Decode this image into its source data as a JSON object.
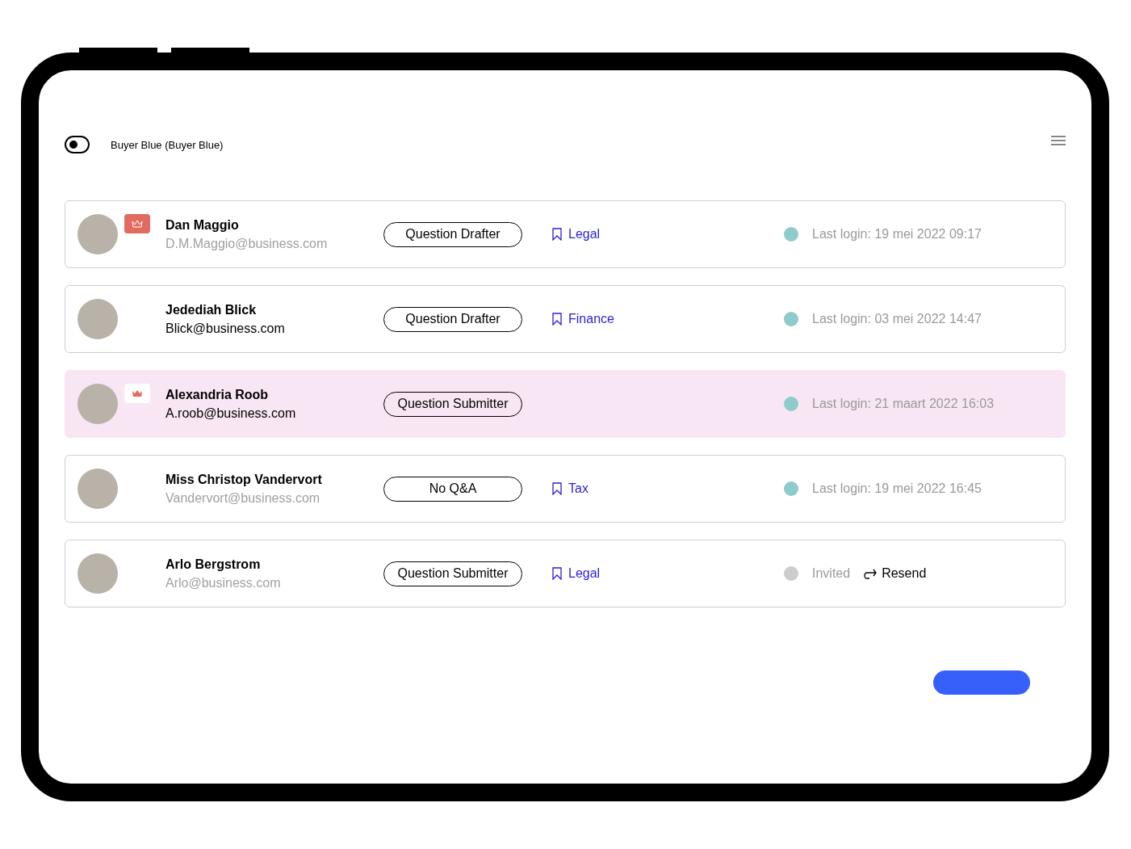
{
  "header": {
    "toggle_on": false,
    "account": "Buyer Blue (Buyer Blue)"
  },
  "users": [
    {
      "name": "Dan Maggio",
      "email": "D.M.Maggio@business.com",
      "email_muted": true,
      "badge": {
        "kind": "outline"
      },
      "role": "Question Drafter",
      "tag": "Legal",
      "color": "#8ecbcb",
      "status": "Last login: 19 mei 2022 09:17",
      "selected": false
    },
    {
      "name": "Jedediah Blick",
      "email": "Blick@business.com",
      "email_muted": false,
      "role": "Question Drafter",
      "tag": "Finance",
      "color": "#8ecbcb",
      "status": "Last login: 03 mei 2022 14:47",
      "selected": false
    },
    {
      "name": "Alexandria Roob",
      "email": "A.roob@business.com",
      "email_muted": false,
      "badge": {
        "kind": "filled"
      },
      "role": "Question Submitter",
      "color": "#8ecbcb",
      "status": "Last login: 21 maart 2022 16:03",
      "selected": true
    },
    {
      "name": "Miss Christop Vandervort",
      "email": "Vandervort@business.com",
      "email_muted": true,
      "role": "No Q&A",
      "tag": "Tax",
      "color": "#8ecbcb",
      "status": "Last login: 19 mei 2022 16:45",
      "selected": false
    },
    {
      "name": "Arlo Bergstrom",
      "email": "Arlo@business.com",
      "email_muted": true,
      "role": "Question Submitter",
      "tag": "Legal",
      "color": "#cccccc",
      "status": "Invited",
      "action": "Resend",
      "selected": false
    }
  ]
}
